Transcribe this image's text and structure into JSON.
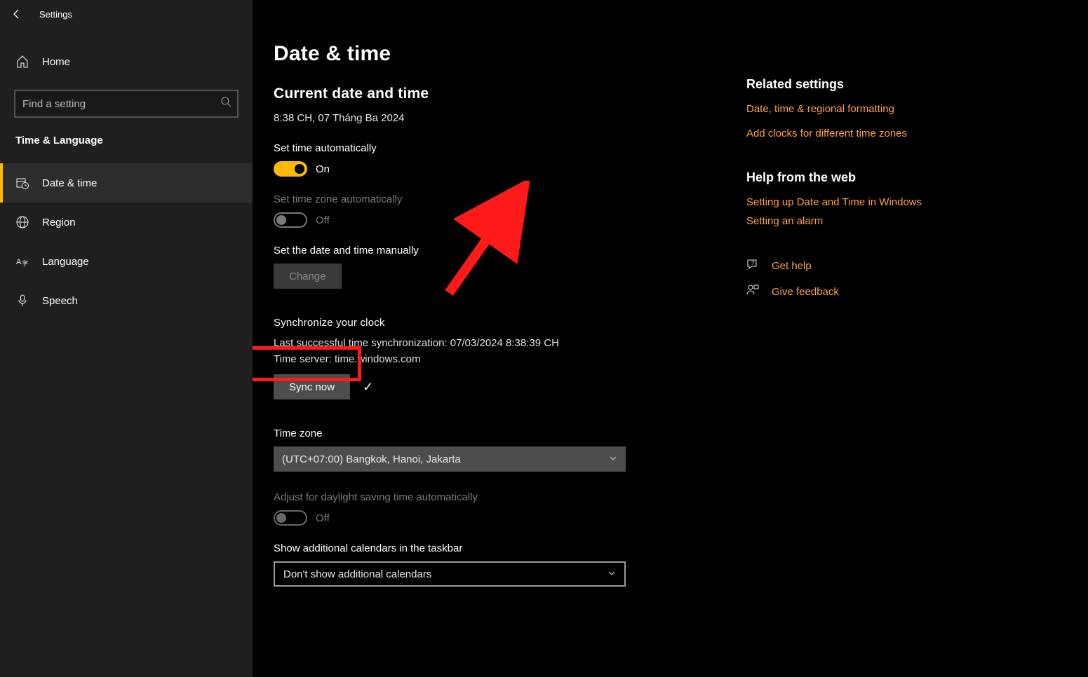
{
  "titlebar": {
    "title": "Settings"
  },
  "sidebar": {
    "home": "Home",
    "search_placeholder": "Find a setting",
    "category": "Time & Language",
    "items": [
      {
        "label": "Date & time",
        "active": true
      },
      {
        "label": "Region"
      },
      {
        "label": "Language"
      },
      {
        "label": "Speech"
      }
    ]
  },
  "main": {
    "heading": "Date & time",
    "current_h": "Current date and time",
    "current_v": "8:38 CH, 07 Tháng Ba 2024",
    "auto_time_lbl": "Set time automatically",
    "auto_time_state": "On",
    "auto_tz_lbl": "Set time zone automatically",
    "auto_tz_state": "Off",
    "manual_lbl": "Set the date and time manually",
    "change_btn": "Change",
    "sync_h": "Synchronize your clock",
    "sync_last": "Last successful time synchronization: 07/03/2024 8:38:39 CH",
    "sync_server": "Time server: time.windows.com",
    "sync_btn": "Sync now",
    "tz_lbl": "Time zone",
    "tz_val": "(UTC+07:00) Bangkok, Hanoi, Jakarta",
    "dst_lbl": "Adjust for daylight saving time automatically",
    "dst_state": "Off",
    "addcal_lbl": "Show additional calendars in the taskbar",
    "addcal_val": "Don't show additional calendars"
  },
  "right": {
    "related_h": "Related settings",
    "l1": "Date, time & regional formatting",
    "l2": "Add clocks for different time zones",
    "help_h": "Help from the web",
    "l3": "Setting up Date and Time in Windows",
    "l4": "Setting an alarm",
    "gethelp": "Get help",
    "feedback": "Give feedback"
  }
}
